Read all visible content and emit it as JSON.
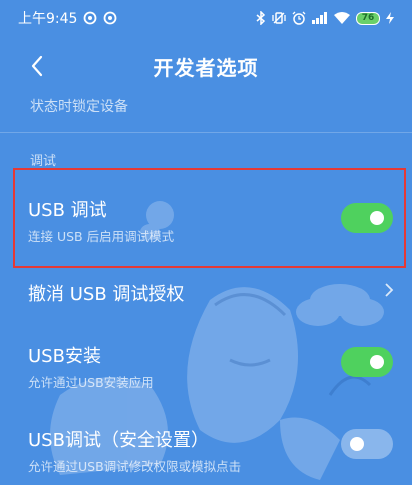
{
  "status_bar": {
    "time": "上午9:45",
    "battery_level": "76",
    "icons": [
      "notification-icon",
      "notification-icon",
      "bluetooth-icon",
      "vibrate-icon",
      "alarm-icon",
      "signal-icon",
      "wifi-icon",
      "battery-icon",
      "charging-icon"
    ]
  },
  "header": {
    "title": "开发者选项"
  },
  "partial_item": {
    "title": "状态时锁定设备"
  },
  "section": {
    "title": "调试"
  },
  "items": [
    {
      "title": "USB 调试",
      "subtitle": "连接 USB 后启用调试模式",
      "toggle": "on",
      "highlighted": true
    },
    {
      "title": "撤消 USB 调试授权",
      "subtitle": "",
      "control": "chevron-right-icon"
    },
    {
      "title": "USB安装",
      "subtitle": "允许通过USB安装应用",
      "toggle": "on"
    },
    {
      "title": "USB调试（安全设置）",
      "subtitle": "允许通过USB调试修改权限或模拟点击",
      "toggle": "off"
    }
  ],
  "colors": {
    "background": "#4a8fe2",
    "toggle_on": "#4fd15e",
    "highlight_border": "#e53935"
  }
}
